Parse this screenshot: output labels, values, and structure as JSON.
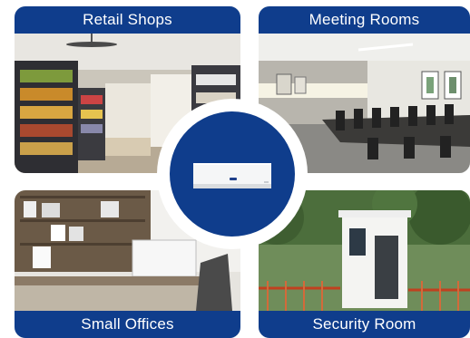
{
  "tiles": {
    "retail": {
      "label": "Retail Shops"
    },
    "meeting": {
      "label": "Meeting Rooms"
    },
    "offices": {
      "label": "Small Offices"
    },
    "security": {
      "label": "Security Room"
    }
  },
  "center": {
    "icon": "air-conditioner-icon"
  },
  "colors": {
    "label_bg": "#0f3d8c",
    "label_text": "#ffffff",
    "badge_ring": "#ffffff"
  }
}
